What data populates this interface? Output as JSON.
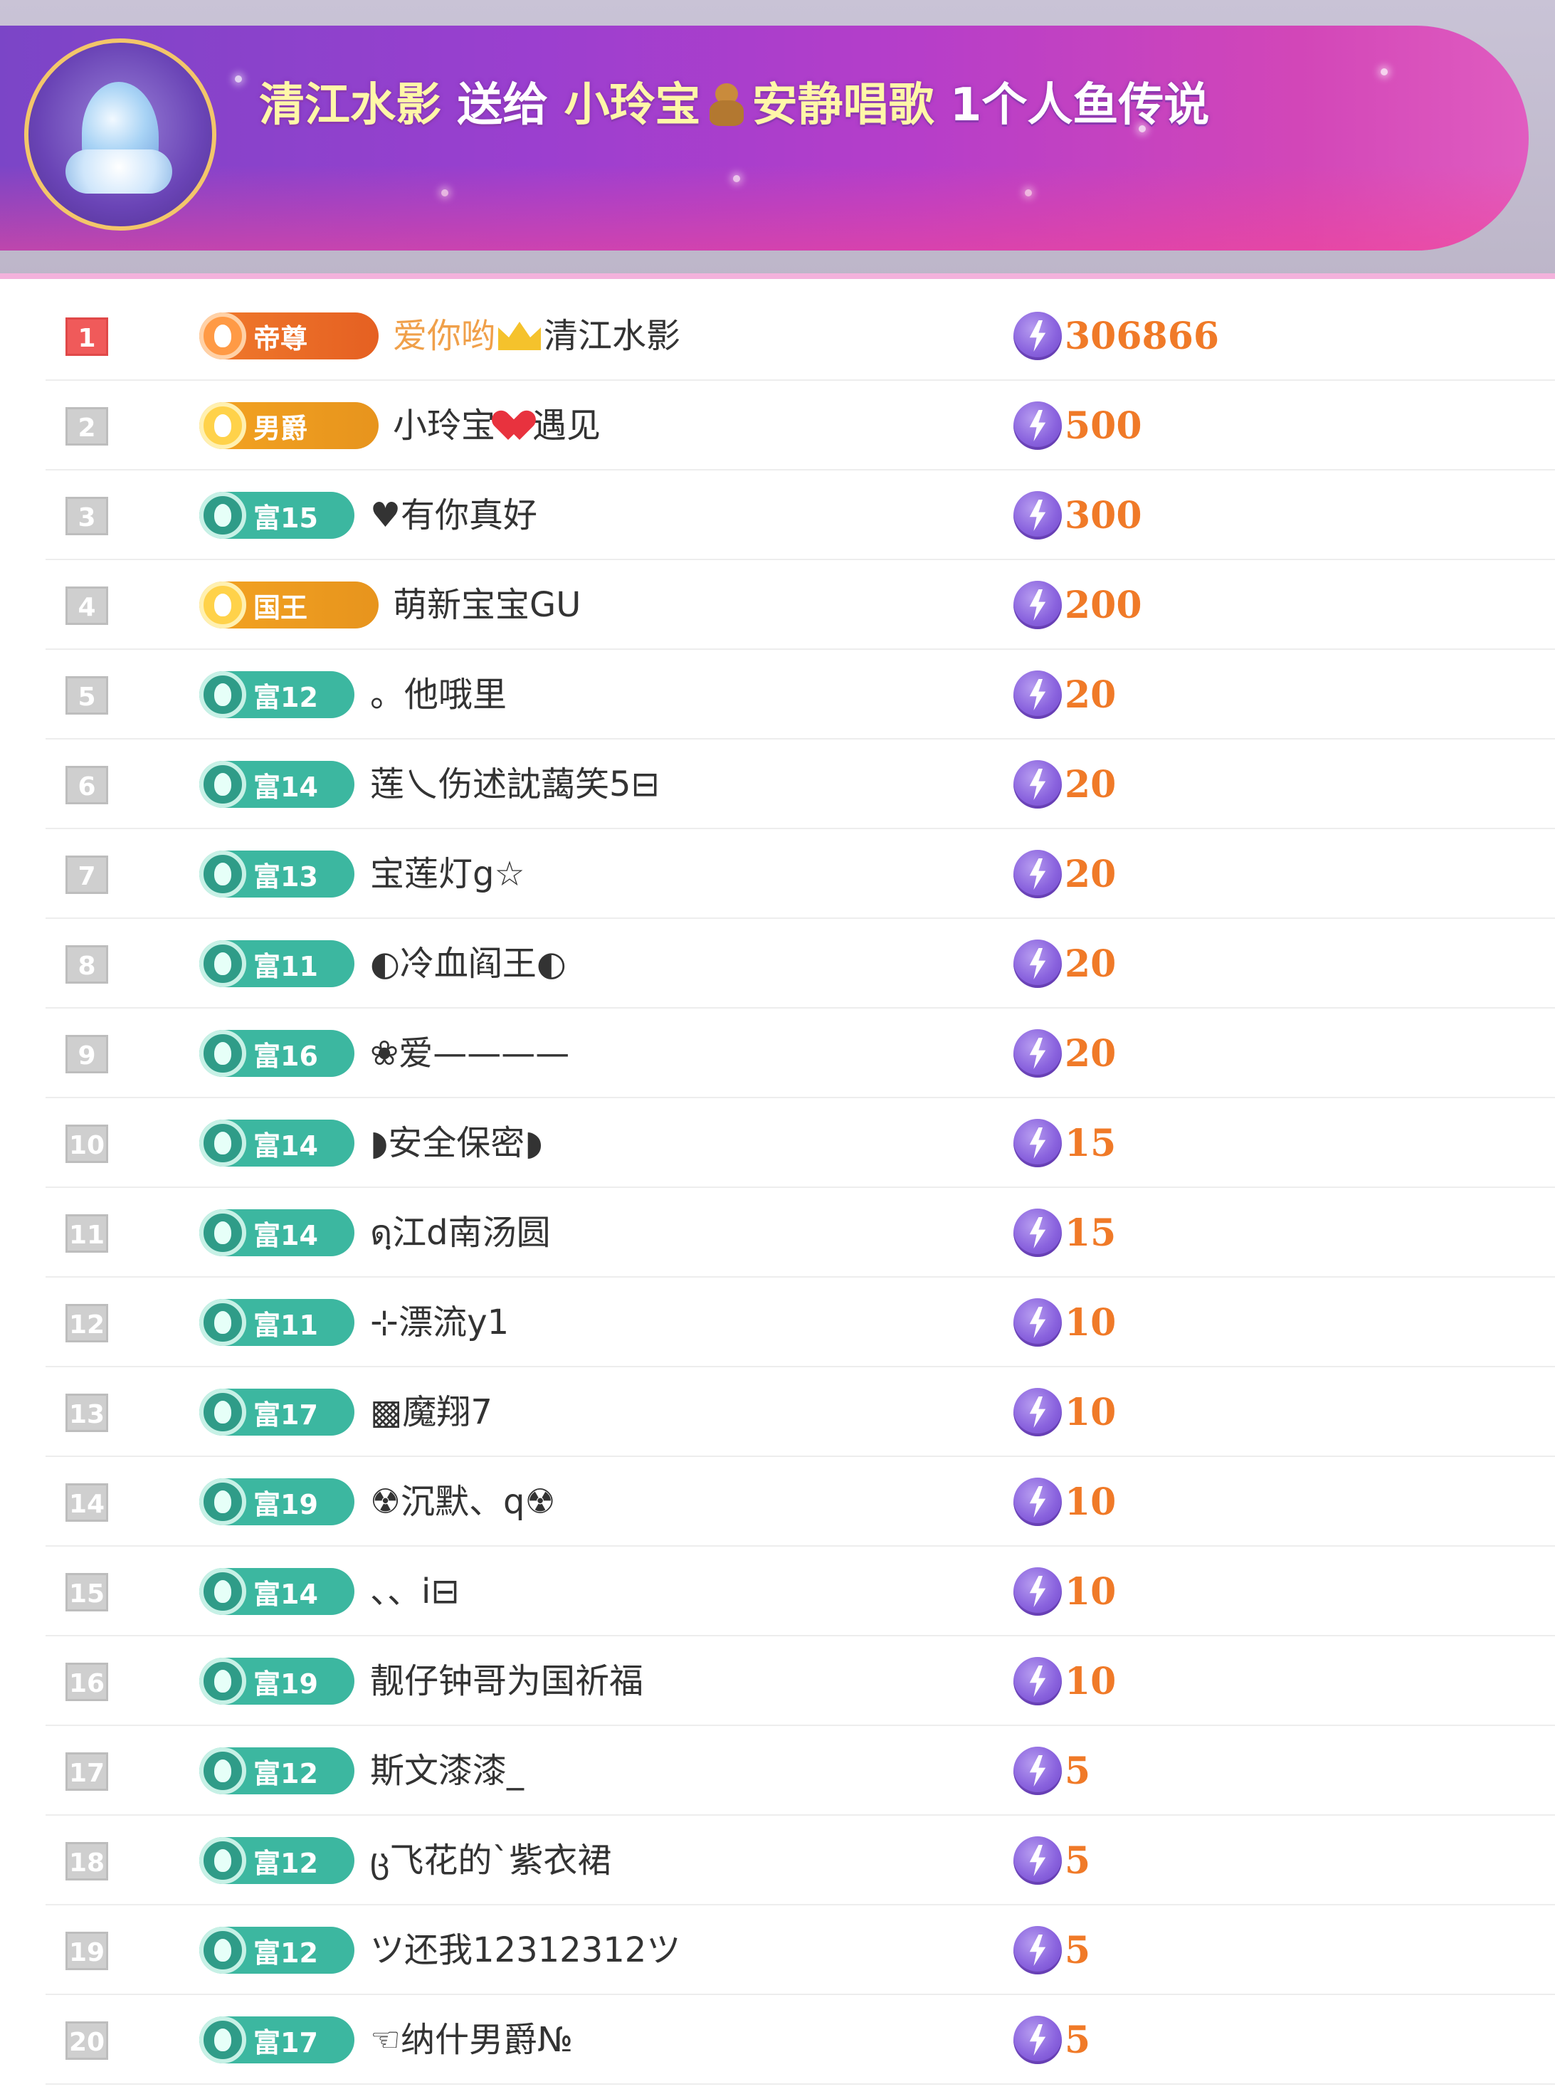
{
  "banner": {
    "sender": "清江水影",
    "verb": "送给",
    "receiver_a": "小玲宝",
    "receiver_b": "安静唱歌",
    "gift_text": "1个人鱼传说",
    "avatar_icon": "gift-avatar-icon",
    "receiver_icon": "bear-icon"
  },
  "colors": {
    "rank_first": "#f05a5a",
    "rank_default": "#cfcfcf",
    "badge_rich": "#3cb7a0",
    "badge_gold": "#f3a322",
    "badge_emperor": "#f07a2c",
    "amount": "#f07a28",
    "banner_purple": "#9b3fcf",
    "banner_pink": "#e05cc0"
  },
  "rows": [
    {
      "rank": "1",
      "badge": "帝尊",
      "prefix": "爱你哟",
      "name": "清江水影",
      "amount": "306866"
    },
    {
      "rank": "2",
      "badge": "男爵",
      "name": "小玲宝",
      "suffix": "遇见",
      "amount": "500"
    },
    {
      "rank": "3",
      "badge": "富15",
      "name": "♥有你真好",
      "amount": "300"
    },
    {
      "rank": "4",
      "badge": "国王",
      "name": "萌新宝宝GU",
      "amount": "200"
    },
    {
      "rank": "5",
      "badge": "富12",
      "name": "。他哦里",
      "amount": "20"
    },
    {
      "rank": "6",
      "badge": "富14",
      "name": "莲乀伤述訦藹笑5⊟",
      "amount": "20"
    },
    {
      "rank": "7",
      "badge": "富13",
      "name": "宝莲灯g☆",
      "amount": "20"
    },
    {
      "rank": "8",
      "badge": "富11",
      "name": "◐冷血阎王◐",
      "amount": "20"
    },
    {
      "rank": "9",
      "badge": "富16",
      "name": "❀爱————",
      "amount": "20"
    },
    {
      "rank": "10",
      "badge": "富14",
      "name": "◗安全保密◗",
      "amount": "15"
    },
    {
      "rank": "11",
      "badge": "富14",
      "name": "ดฺ江d南汤圆",
      "amount": "15"
    },
    {
      "rank": "12",
      "badge": "富11",
      "name": "⊹漂流y1",
      "amount": "10"
    },
    {
      "rank": "13",
      "badge": "富17",
      "name": "▩魔翔7",
      "amount": "10"
    },
    {
      "rank": "14",
      "badge": "富19",
      "name": "☢沉默、q☢",
      "amount": "10"
    },
    {
      "rank": "15",
      "badge": "富14",
      "name": "、、i⊟",
      "amount": "10"
    },
    {
      "rank": "16",
      "badge": "富19",
      "name": "靓仔钟哥为国祈福",
      "amount": "10"
    },
    {
      "rank": "17",
      "badge": "富12",
      "name": "斯文漆漆_",
      "amount": "5"
    },
    {
      "rank": "18",
      "badge": "富12",
      "name": "ც飞花的`紫衣裙",
      "amount": "5"
    },
    {
      "rank": "19",
      "badge": "富12",
      "name": "ツ还我12312312ツ",
      "amount": "5"
    },
    {
      "rank": "20",
      "badge": "富17",
      "name": "☜纳什男爵№",
      "amount": "5"
    }
  ]
}
